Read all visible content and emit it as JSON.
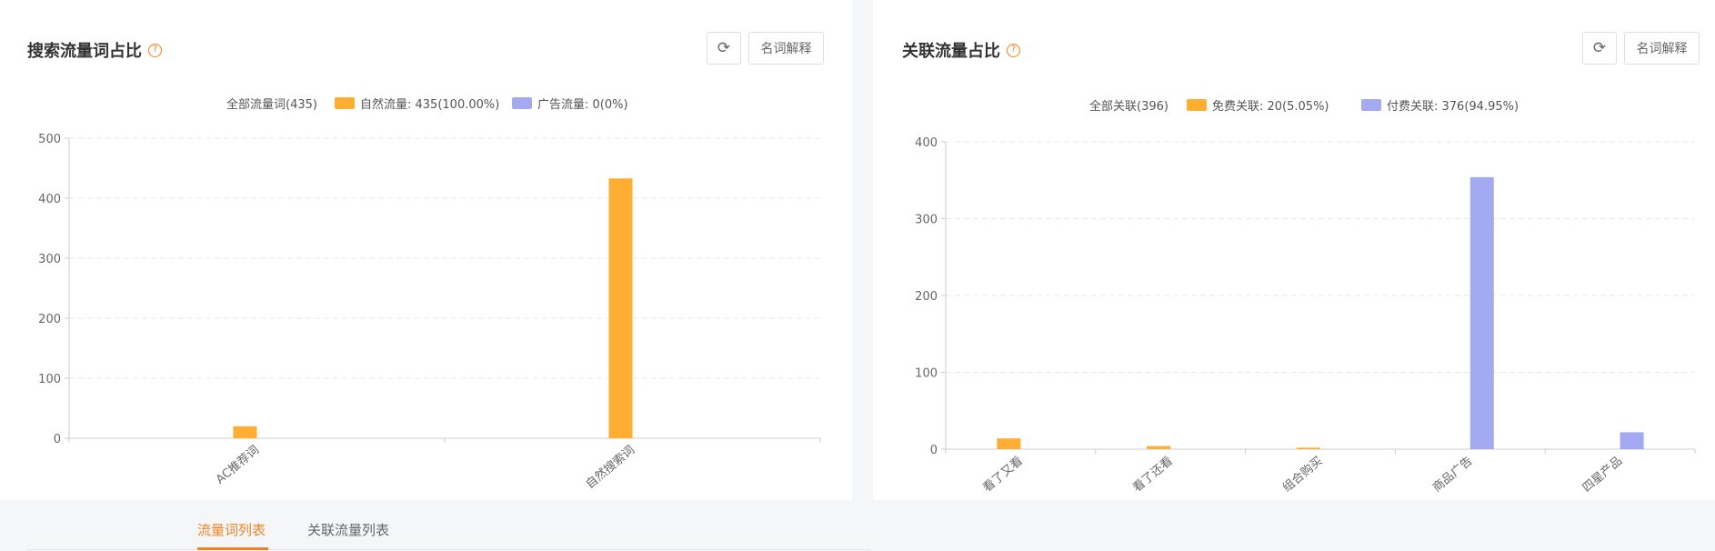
{
  "left": {
    "title": "搜索流量词占比",
    "refresh_icon": "refresh-icon",
    "explain_label": "名词解释",
    "legend": {
      "total": "全部流量词(435)",
      "series1": "自然流量: 435(100.00%)",
      "series2": "广告流量: 0(0%)"
    }
  },
  "right": {
    "title": "关联流量占比",
    "refresh_icon": "refresh-icon",
    "explain_label": "名词解释",
    "legend": {
      "total": "全部关联(396)",
      "series1": "免费关联: 20(5.05%)",
      "series2": "付费关联: 376(94.95%)"
    }
  },
  "tabs": [
    {
      "label": "流量词列表",
      "active": true
    },
    {
      "label": "关联流量列表",
      "active": false
    }
  ],
  "colors": {
    "orange": "#ffad33",
    "purple": "#a3aaf2",
    "accent": "#f0821e"
  },
  "chart_data": [
    {
      "type": "bar",
      "categories": [
        "AC推荐词",
        "自然搜索词"
      ],
      "series": [
        {
          "name": "自然流量",
          "color": "#ffad33",
          "values": [
            20,
            433
          ]
        },
        {
          "name": "广告流量",
          "color": "#a3aaf2",
          "values": [
            0,
            0
          ]
        }
      ],
      "ylim": [
        0,
        500
      ],
      "yticks": [
        0,
        100,
        200,
        300,
        400,
        500
      ],
      "grid": true,
      "legend": "top-center"
    },
    {
      "type": "bar",
      "categories": [
        "看了又看",
        "看了还看",
        "组合购买",
        "商品广告",
        "四星产品"
      ],
      "series": [
        {
          "name": "免费关联",
          "color": "#ffad33",
          "values": [
            14,
            4,
            2,
            0,
            0
          ]
        },
        {
          "name": "付费关联",
          "color": "#a3aaf2",
          "values": [
            0,
            0,
            0,
            354,
            22
          ]
        }
      ],
      "ylim": [
        0,
        400
      ],
      "yticks": [
        0,
        100,
        200,
        300,
        400
      ],
      "grid": true,
      "legend": "top-center"
    }
  ]
}
